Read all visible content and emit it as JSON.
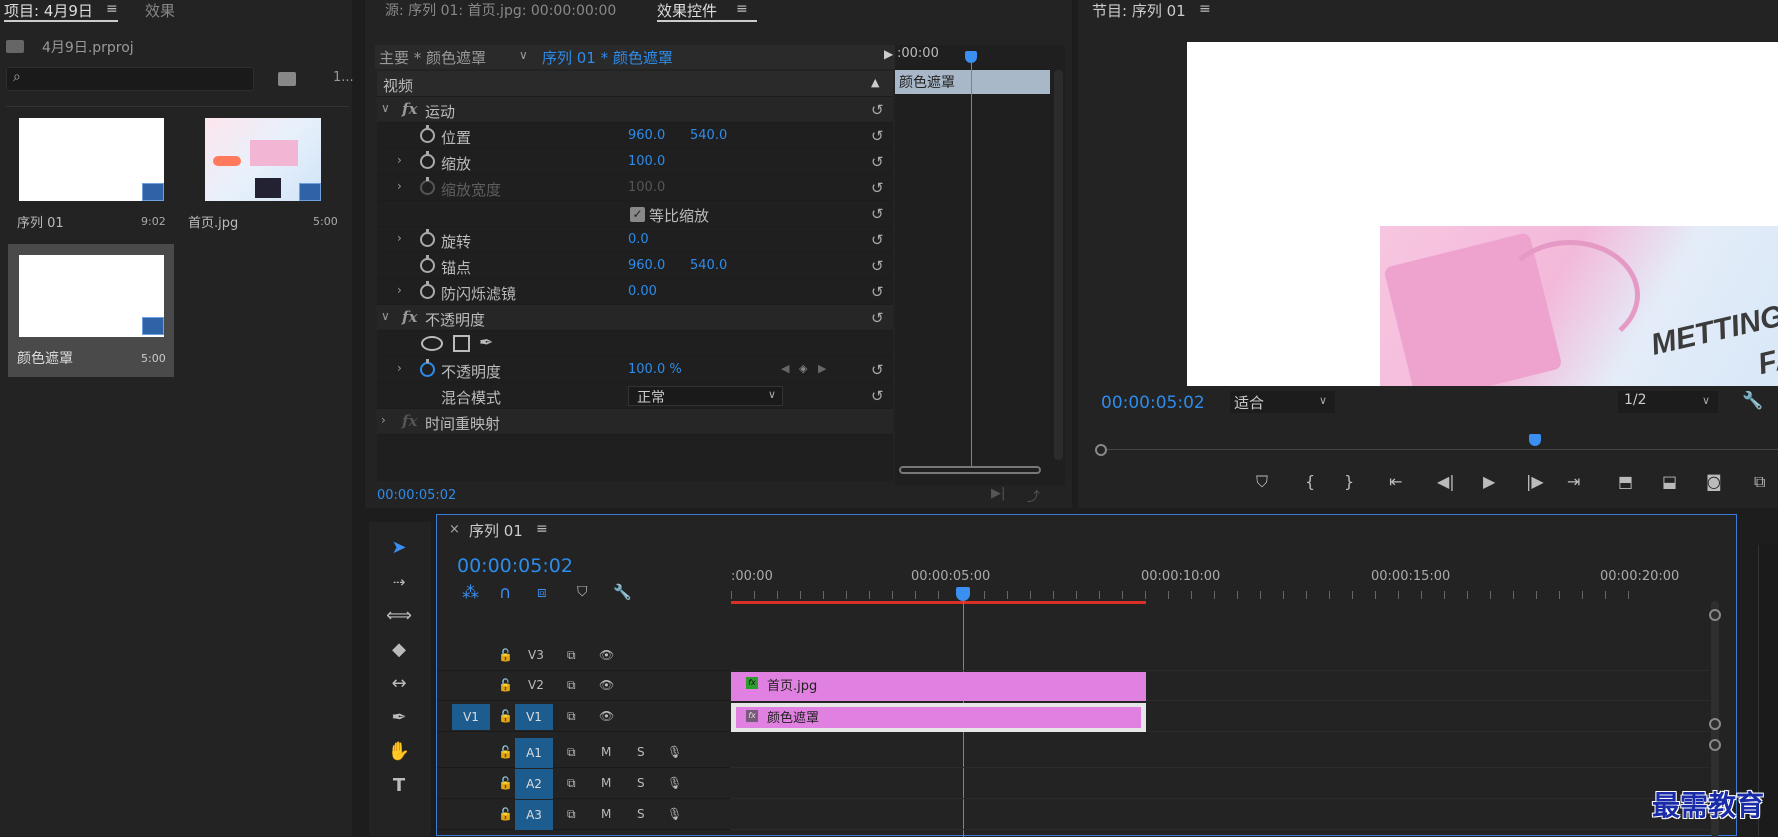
{
  "project_panel": {
    "tab_project": "项目: 4月9日",
    "tab_effects": "效果",
    "file_name": "4月9日.prproj",
    "search_placeholder": "",
    "count": "1...",
    "items": [
      {
        "name": "序列 01",
        "duration": "9:02"
      },
      {
        "name": "首页.jpg",
        "duration": "5:00"
      },
      {
        "name": "颜色遮罩",
        "duration": "5:00"
      }
    ]
  },
  "effect_controls": {
    "tab_source": "源: 序列 01: 首页.jpg: 00:00:00:00",
    "tab_effects": "效果控件",
    "master_label": "主要 * 颜色遮罩",
    "sequence_label": "序列 01 * 颜色遮罩",
    "section_video": "视频",
    "timeline_time": ":00:00",
    "clip_label": "颜色遮罩",
    "footer_time": "00:00:05:02",
    "rows": {
      "motion": "运动",
      "position": "位置",
      "position_x": "960.0",
      "position_y": "540.0",
      "scale": "缩放",
      "scale_value": "100.0",
      "scale_width": "缩放宽度",
      "scale_width_value": "100.0",
      "uniform_scale": "等比缩放",
      "rotation": "旋转",
      "rotation_value": "0.0",
      "anchor": "锚点",
      "anchor_x": "960.0",
      "anchor_y": "540.0",
      "anti_flicker": "防闪烁滤镜",
      "anti_flicker_value": "0.00",
      "opacity_group": "不透明度",
      "opacity": "不透明度",
      "opacity_value": "100.0 %",
      "blend_mode": "混合模式",
      "blend_value": "正常",
      "time_remap": "时间重映射"
    }
  },
  "program_monitor": {
    "title": "节目: 序列 01",
    "timecode": "00:00:05:02",
    "fit": "适合",
    "resolution": "1/2",
    "image_text_1": "METTING",
    "image_text_2": "FAS"
  },
  "timeline": {
    "title": "序列 01",
    "timecode": "00:00:05:02",
    "ruler": [
      ":00:00",
      "00:00:05:00",
      "00:00:10:00",
      "00:00:15:00",
      "00:00:20:00"
    ],
    "tracks": [
      {
        "id": "V3"
      },
      {
        "id": "V2"
      },
      {
        "id": "V1",
        "source": "V1"
      },
      {
        "id": "A1",
        "m": "M",
        "s": "S"
      },
      {
        "id": "A2",
        "m": "M",
        "s": "S"
      },
      {
        "id": "A3",
        "m": "M",
        "s": "S"
      }
    ],
    "clips": {
      "v2": "首页.jpg",
      "v1": "颜色遮罩"
    }
  },
  "watermark": "最需教育",
  "colors": {
    "accent": "#2d8ceb",
    "clip": "#e080e0",
    "work_area": "#d93025"
  }
}
